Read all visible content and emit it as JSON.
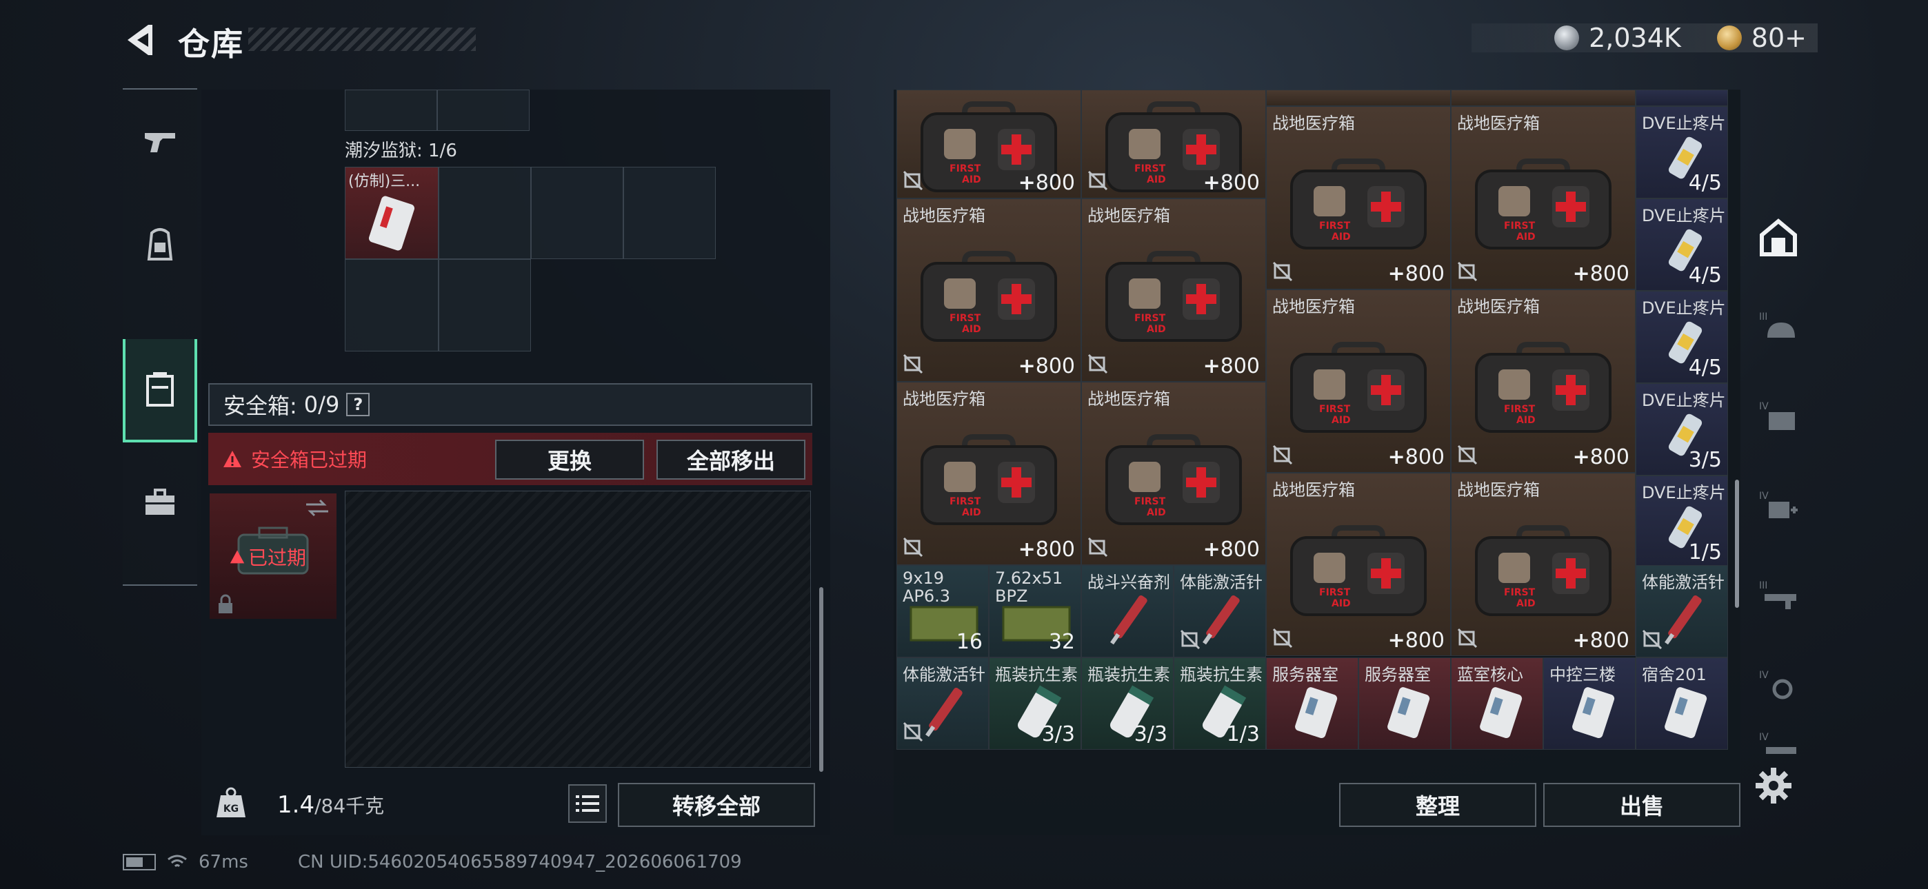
{
  "header": {
    "title": "仓库",
    "silver_amount": "2,034K",
    "gold_amount": "80+"
  },
  "left_nav": {
    "items": [
      {
        "icon": "pistol-icon"
      },
      {
        "icon": "backpack-icon"
      },
      {
        "icon": "vest-icon",
        "active": true
      },
      {
        "icon": "briefcase-icon"
      }
    ]
  },
  "container": {
    "title": "潮汐监狱: 1/6",
    "item_name": "(仿制)三..."
  },
  "safe_box": {
    "label": "安全箱:",
    "count": "0/9",
    "help": "?",
    "expired_notice": "安全箱已过期",
    "replace_button": "更换",
    "remove_all_button": "全部移出",
    "expired_badge": "已过期"
  },
  "weight": {
    "current": "1.4",
    "max": "/84千克",
    "transfer_all_button": "转移全部"
  },
  "inventory": {
    "col1": [
      {
        "name": "",
        "value": "+800",
        "type": "medkit"
      },
      {
        "name": "战地医疗箱",
        "value": "+800",
        "type": "medkit"
      },
      {
        "name": "战地医疗箱",
        "value": "+800",
        "type": "medkit"
      }
    ],
    "col2": [
      {
        "name": "",
        "value": "+800",
        "type": "medkit"
      },
      {
        "name": "战地医疗箱",
        "value": "+800",
        "type": "medkit"
      },
      {
        "name": "战地医疗箱",
        "value": "+800",
        "type": "medkit"
      }
    ],
    "col3": [
      {
        "name": "战地医疗箱",
        "value": "+800"
      },
      {
        "name": "战地医疗箱",
        "value": "+800"
      },
      {
        "name": "战地医疗箱",
        "value": "+800"
      }
    ],
    "col4": [
      {
        "name": "战地医疗箱",
        "value": "+800"
      },
      {
        "name": "战地医疗箱",
        "value": "+800"
      },
      {
        "name": "战地医疗箱",
        "value": "+800"
      }
    ],
    "dve": [
      {
        "name": "DVE止疼片",
        "value": "4/5"
      },
      {
        "name": "DVE止疼片",
        "value": "4/5"
      },
      {
        "name": "DVE止疼片",
        "value": "4/5"
      },
      {
        "name": "DVE止疼片",
        "value": "3/5"
      },
      {
        "name": "DVE止疼片",
        "value": "1/5"
      }
    ],
    "row5": [
      {
        "name": "9x19",
        "sub": "AP6.3",
        "value": "16"
      },
      {
        "name": "7.62x51",
        "sub": "BPZ",
        "value": "32"
      },
      {
        "name": "战斗兴奋剂",
        "value": ""
      },
      {
        "name": "体能激活针",
        "value": ""
      },
      {
        "name": "体能激活针",
        "value": ""
      }
    ],
    "row6": [
      {
        "name": "体能激活针",
        "value": ""
      },
      {
        "name": "瓶装抗生素",
        "value": "3/3"
      },
      {
        "name": "瓶装抗生素",
        "value": "3/3"
      },
      {
        "name": "瓶装抗生素",
        "value": "1/3"
      },
      {
        "name": "服务器室",
        "value": ""
      },
      {
        "name": "服务器室",
        "value": ""
      },
      {
        "name": "蓝室核心",
        "value": ""
      },
      {
        "name": "中控三楼",
        "value": ""
      },
      {
        "name": "宿舍201",
        "value": ""
      }
    ],
    "sort_button": "整理",
    "sell_button": "出售"
  },
  "right_nav": {
    "items": [
      {
        "icon": "warehouse-icon",
        "active": true
      },
      {
        "icon": "tier3-helmet-icon"
      },
      {
        "icon": "tier4-box-icon"
      },
      {
        "icon": "tier4-medical-icon"
      },
      {
        "icon": "tier3-rifle-icon"
      },
      {
        "icon": "tier4-gear-icon"
      },
      {
        "icon": "tier4-weapon-icon"
      }
    ]
  },
  "status": {
    "ping": "67ms",
    "uid": "CN UID:546020540655897409​47_202606061709"
  },
  "colors": {
    "accent": "#5ee0b0",
    "danger": "#ff4a55",
    "panel": "#12181e"
  }
}
